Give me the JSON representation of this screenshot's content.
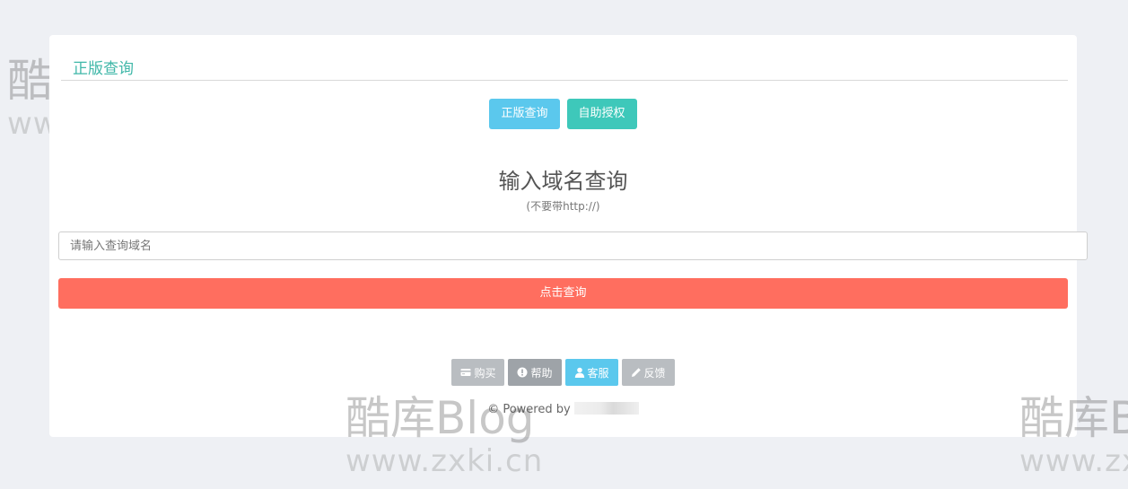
{
  "panel": {
    "title": "正版查询"
  },
  "tabs": [
    {
      "label": "正版查询",
      "color": "#5bc8ed"
    },
    {
      "label": "自助授权",
      "color": "#3ec8ba"
    }
  ],
  "query": {
    "heading": "输入域名查询",
    "note": "(不要带http://)",
    "input_placeholder": "请输入查询域名",
    "input_value": "",
    "submit_label": "点击查询",
    "submit_color": "#ff6e5f"
  },
  "footer": {
    "buttons": [
      {
        "label": "购买",
        "icon": "card-icon"
      },
      {
        "label": "帮助",
        "icon": "alert-circle-icon"
      },
      {
        "label": "客服",
        "icon": "user-icon"
      },
      {
        "label": "反馈",
        "icon": "pencil-icon"
      }
    ],
    "powered_by": "© Powered by"
  },
  "watermark": {
    "brand": "酷库Blog",
    "url": "www.zxki.cn"
  }
}
